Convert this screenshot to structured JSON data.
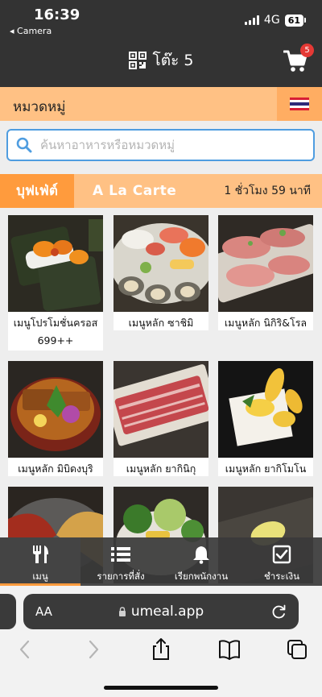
{
  "status_bar": {
    "time": "16:39",
    "back_app": "◂ Camera",
    "network": "4G",
    "battery": "61"
  },
  "header": {
    "table_label": "โต๊ะ 5",
    "cart_count": "5"
  },
  "category": {
    "label": "หมวดหมู่",
    "language_flag": "thai-flag-icon"
  },
  "search": {
    "placeholder": "ค้นหาอาหารหรือหมวดหมู่",
    "value": ""
  },
  "modes": {
    "buffet": "บุฟเฟ่ต์",
    "alacarte": "A La Carte",
    "timer": "1 ชั่วโมง 59 นาที"
  },
  "menu_items": [
    {
      "name": "เมนูโปรโมชั่นครอส",
      "subtitle": "699++"
    },
    {
      "name": "เมนูหลัก ซาชิมิ"
    },
    {
      "name": "เมนูหลัก นิกิริ&โรล"
    },
    {
      "name": "เมนูหลัก มิบิดงบุริ"
    },
    {
      "name": "เมนูหลัก ยากินิกุ"
    },
    {
      "name": "เมนูหลัก ยากิโมโน"
    },
    {
      "name": ""
    },
    {
      "name": ""
    },
    {
      "name": ""
    }
  ],
  "tabs": [
    {
      "label": "เมนู",
      "icon": "utensils-icon",
      "active": true
    },
    {
      "label": "รายการที่สั่ง",
      "icon": "list-icon",
      "active": false
    },
    {
      "label": "เรียกพนักงาน",
      "icon": "bell-icon",
      "active": false
    },
    {
      "label": "ชำระเงิน",
      "icon": "checkbox-icon",
      "active": false
    }
  ],
  "browser": {
    "aa": "AA",
    "url": "umeal.app"
  },
  "colors": {
    "accent": "#ff9b3d",
    "header": "#333333",
    "band": "#ffc184",
    "search_border": "#4f9de0"
  }
}
